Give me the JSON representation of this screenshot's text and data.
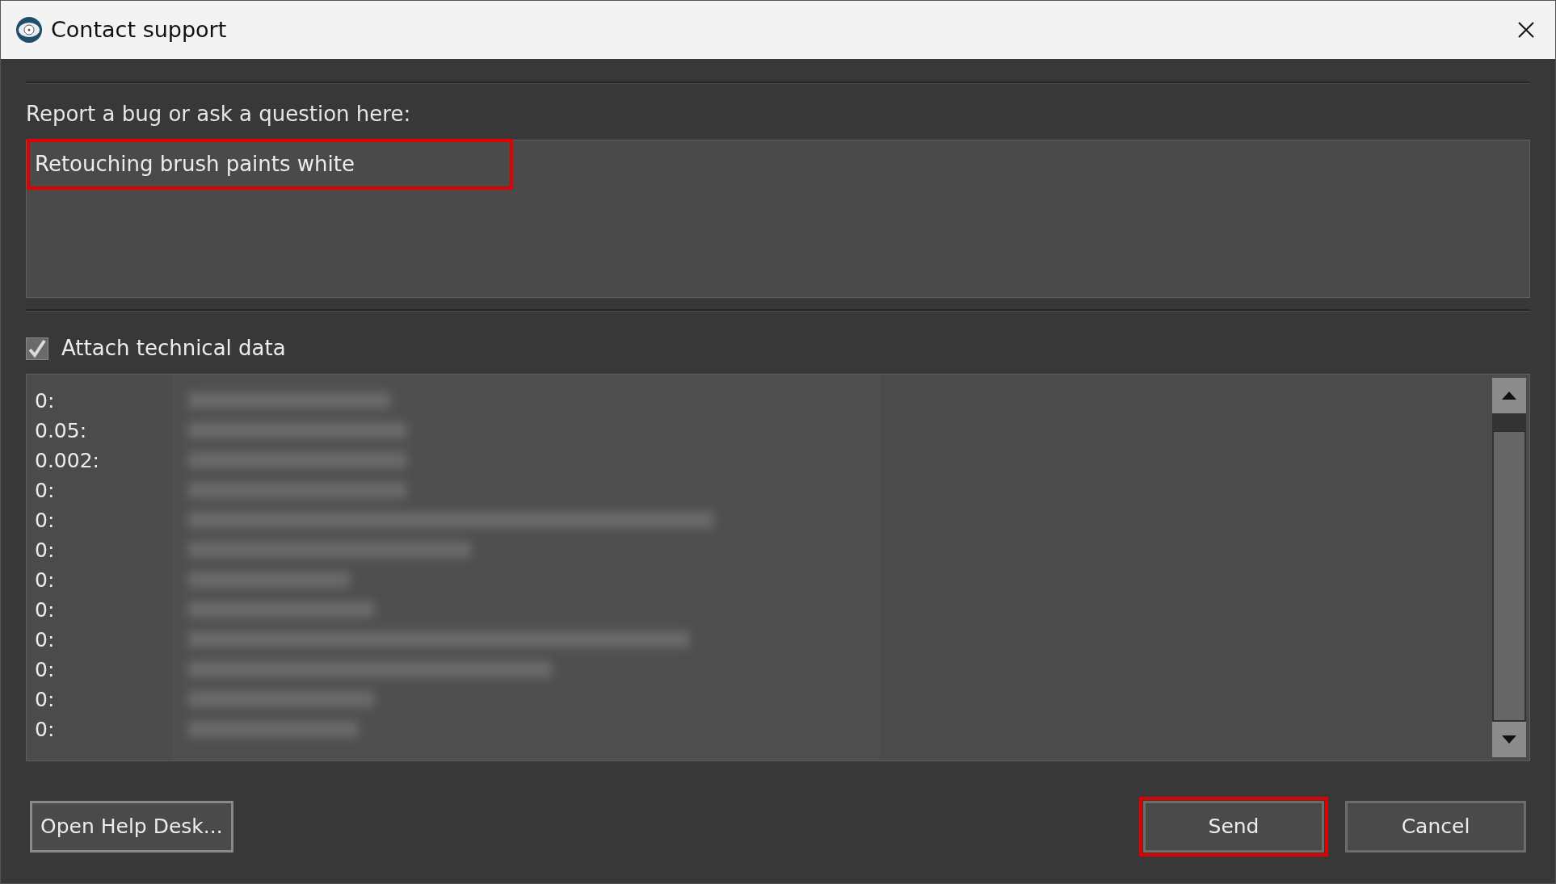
{
  "window": {
    "title": "Contact support"
  },
  "prompt": "Report a bug or ask a question here:",
  "message": {
    "value": "Retouching brush paints white",
    "highlighted": true
  },
  "attach": {
    "label": "Attach technical data",
    "checked": true
  },
  "tech_rows": [
    {
      "key": "0:"
    },
    {
      "key": "0.05:"
    },
    {
      "key": "0.002:"
    },
    {
      "key": "0:"
    },
    {
      "key": "0:"
    },
    {
      "key": "0:"
    },
    {
      "key": "0:"
    },
    {
      "key": "0:"
    },
    {
      "key": "0:"
    },
    {
      "key": "0:"
    },
    {
      "key": "0:"
    },
    {
      "key": "0:"
    }
  ],
  "buttons": [
    {
      "label": "Open Help Desk...",
      "kind": "left",
      "highlighted": false
    },
    {
      "label": "Send",
      "kind": "right",
      "highlighted": true
    },
    {
      "label": "Cancel",
      "kind": "right",
      "highlighted": false
    }
  ]
}
